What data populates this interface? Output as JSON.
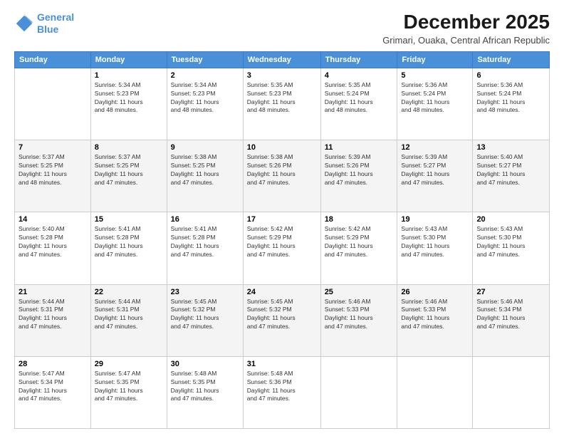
{
  "logo": {
    "line1": "General",
    "line2": "Blue"
  },
  "title": "December 2025",
  "subtitle": "Grimari, Ouaka, Central African Republic",
  "days_of_week": [
    "Sunday",
    "Monday",
    "Tuesday",
    "Wednesday",
    "Thursday",
    "Friday",
    "Saturday"
  ],
  "weeks": [
    [
      {
        "day": "",
        "info": ""
      },
      {
        "day": "1",
        "info": "Sunrise: 5:34 AM\nSunset: 5:23 PM\nDaylight: 11 hours\nand 48 minutes."
      },
      {
        "day": "2",
        "info": "Sunrise: 5:34 AM\nSunset: 5:23 PM\nDaylight: 11 hours\nand 48 minutes."
      },
      {
        "day": "3",
        "info": "Sunrise: 5:35 AM\nSunset: 5:23 PM\nDaylight: 11 hours\nand 48 minutes."
      },
      {
        "day": "4",
        "info": "Sunrise: 5:35 AM\nSunset: 5:24 PM\nDaylight: 11 hours\nand 48 minutes."
      },
      {
        "day": "5",
        "info": "Sunrise: 5:36 AM\nSunset: 5:24 PM\nDaylight: 11 hours\nand 48 minutes."
      },
      {
        "day": "6",
        "info": "Sunrise: 5:36 AM\nSunset: 5:24 PM\nDaylight: 11 hours\nand 48 minutes."
      }
    ],
    [
      {
        "day": "7",
        "info": "Sunrise: 5:37 AM\nSunset: 5:25 PM\nDaylight: 11 hours\nand 48 minutes."
      },
      {
        "day": "8",
        "info": "Sunrise: 5:37 AM\nSunset: 5:25 PM\nDaylight: 11 hours\nand 47 minutes."
      },
      {
        "day": "9",
        "info": "Sunrise: 5:38 AM\nSunset: 5:25 PM\nDaylight: 11 hours\nand 47 minutes."
      },
      {
        "day": "10",
        "info": "Sunrise: 5:38 AM\nSunset: 5:26 PM\nDaylight: 11 hours\nand 47 minutes."
      },
      {
        "day": "11",
        "info": "Sunrise: 5:39 AM\nSunset: 5:26 PM\nDaylight: 11 hours\nand 47 minutes."
      },
      {
        "day": "12",
        "info": "Sunrise: 5:39 AM\nSunset: 5:27 PM\nDaylight: 11 hours\nand 47 minutes."
      },
      {
        "day": "13",
        "info": "Sunrise: 5:40 AM\nSunset: 5:27 PM\nDaylight: 11 hours\nand 47 minutes."
      }
    ],
    [
      {
        "day": "14",
        "info": "Sunrise: 5:40 AM\nSunset: 5:28 PM\nDaylight: 11 hours\nand 47 minutes."
      },
      {
        "day": "15",
        "info": "Sunrise: 5:41 AM\nSunset: 5:28 PM\nDaylight: 11 hours\nand 47 minutes."
      },
      {
        "day": "16",
        "info": "Sunrise: 5:41 AM\nSunset: 5:28 PM\nDaylight: 11 hours\nand 47 minutes."
      },
      {
        "day": "17",
        "info": "Sunrise: 5:42 AM\nSunset: 5:29 PM\nDaylight: 11 hours\nand 47 minutes."
      },
      {
        "day": "18",
        "info": "Sunrise: 5:42 AM\nSunset: 5:29 PM\nDaylight: 11 hours\nand 47 minutes."
      },
      {
        "day": "19",
        "info": "Sunrise: 5:43 AM\nSunset: 5:30 PM\nDaylight: 11 hours\nand 47 minutes."
      },
      {
        "day": "20",
        "info": "Sunrise: 5:43 AM\nSunset: 5:30 PM\nDaylight: 11 hours\nand 47 minutes."
      }
    ],
    [
      {
        "day": "21",
        "info": "Sunrise: 5:44 AM\nSunset: 5:31 PM\nDaylight: 11 hours\nand 47 minutes."
      },
      {
        "day": "22",
        "info": "Sunrise: 5:44 AM\nSunset: 5:31 PM\nDaylight: 11 hours\nand 47 minutes."
      },
      {
        "day": "23",
        "info": "Sunrise: 5:45 AM\nSunset: 5:32 PM\nDaylight: 11 hours\nand 47 minutes."
      },
      {
        "day": "24",
        "info": "Sunrise: 5:45 AM\nSunset: 5:32 PM\nDaylight: 11 hours\nand 47 minutes."
      },
      {
        "day": "25",
        "info": "Sunrise: 5:46 AM\nSunset: 5:33 PM\nDaylight: 11 hours\nand 47 minutes."
      },
      {
        "day": "26",
        "info": "Sunrise: 5:46 AM\nSunset: 5:33 PM\nDaylight: 11 hours\nand 47 minutes."
      },
      {
        "day": "27",
        "info": "Sunrise: 5:46 AM\nSunset: 5:34 PM\nDaylight: 11 hours\nand 47 minutes."
      }
    ],
    [
      {
        "day": "28",
        "info": "Sunrise: 5:47 AM\nSunset: 5:34 PM\nDaylight: 11 hours\nand 47 minutes."
      },
      {
        "day": "29",
        "info": "Sunrise: 5:47 AM\nSunset: 5:35 PM\nDaylight: 11 hours\nand 47 minutes."
      },
      {
        "day": "30",
        "info": "Sunrise: 5:48 AM\nSunset: 5:35 PM\nDaylight: 11 hours\nand 47 minutes."
      },
      {
        "day": "31",
        "info": "Sunrise: 5:48 AM\nSunset: 5:36 PM\nDaylight: 11 hours\nand 47 minutes."
      },
      {
        "day": "",
        "info": ""
      },
      {
        "day": "",
        "info": ""
      },
      {
        "day": "",
        "info": ""
      }
    ]
  ]
}
